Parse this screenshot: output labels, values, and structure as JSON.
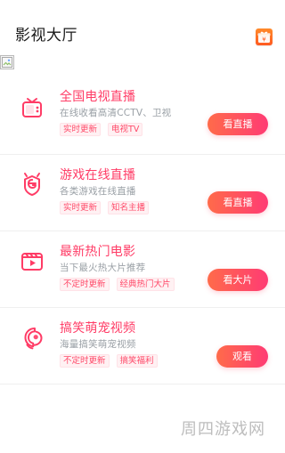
{
  "header": {
    "title": "影视大厅",
    "gift_icon": "gift-icon",
    "gift_label": "¥"
  },
  "cards": [
    {
      "title": "全国电视直播",
      "description": "在线收看高清CCTV、卫视",
      "tags": [
        "实时更新",
        "电视TV"
      ],
      "button": "看直播",
      "icon": "tv-icon"
    },
    {
      "title": "游戏在线直播",
      "description": "各类游戏在线直播",
      "tags": [
        "实时更新",
        "知名主播"
      ],
      "button": "看直播",
      "icon": "game-badge-icon"
    },
    {
      "title": "最新热门电影",
      "description": "当下最火热大片推荐",
      "tags": [
        "不定时更新",
        "经典热门大片"
      ],
      "button": "看大片",
      "icon": "film-play-icon"
    },
    {
      "title": "搞笑萌宠视频",
      "description": "海量搞笑萌宠视频",
      "tags": [
        "不定时更新",
        "搞笑福利"
      ],
      "button": "观看",
      "icon": "person-profile-icon"
    }
  ],
  "footer": {
    "watermark": "周四游戏网"
  },
  "colors": {
    "accent_pink": "#ff3c66",
    "button_gradient_start": "#ff6b4a",
    "button_gradient_end": "#ff3b74",
    "tag_bg": "#fff1f3",
    "tag_text": "#ff4b6a",
    "desc_gray": "#9aa0a6"
  }
}
